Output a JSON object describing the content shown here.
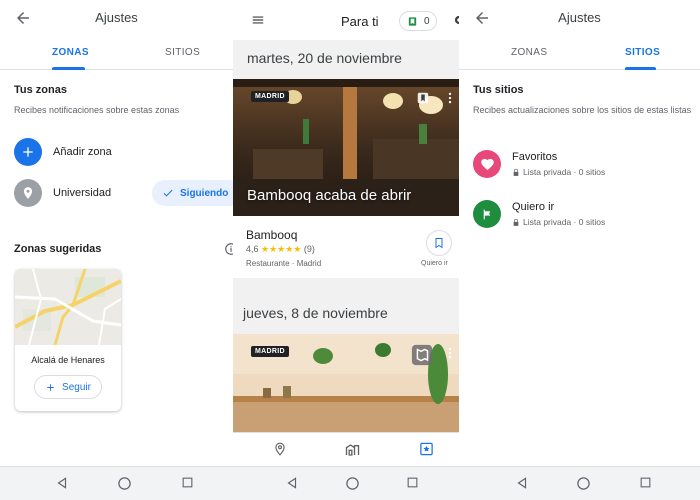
{
  "zones_screen": {
    "title": "Ajustes",
    "tabs": [
      {
        "label": "ZONAS"
      },
      {
        "label": "SITIOS"
      }
    ],
    "section_title": "Tus zonas",
    "section_subtitle": "Recibes notificaciones sobre estas zonas",
    "add_zone_label": "Añadir zona",
    "zone_name": "Universidad",
    "following_label": "Siguiendo",
    "suggested_title": "Zonas sugeridas",
    "suggested_card": {
      "name": "Alcalá de Henares",
      "follow_label": "Seguir"
    }
  },
  "feed_screen": {
    "header_title": "Para ti",
    "header_count": "0",
    "posts": [
      {
        "date": "martes, 20 de noviembre",
        "badge": "MADRID",
        "photo_caption": "Bambooq acaba de abrir",
        "place_name": "Bambooq",
        "rating": "4,6",
        "stars": "★★★★★",
        "reviews": "(9)",
        "category": "Restaurante · Madrid",
        "save_label": "Quiero ir"
      },
      {
        "date": "jueves, 8 de noviembre",
        "badge": "MADRID"
      }
    ]
  },
  "sites_screen": {
    "title": "Ajustes",
    "tabs": [
      {
        "label": "ZONAS"
      },
      {
        "label": "SITIOS"
      }
    ],
    "section_title": "Tus sitios",
    "section_subtitle": "Recibes actualizaciones sobre los sitios de estas listas",
    "lists": [
      {
        "name": "Favoritos",
        "meta": "Lista privada · 0 sitios"
      },
      {
        "name": "Quiero ir",
        "meta": "Lista privada · 0 sitios"
      }
    ]
  },
  "colors": {
    "accent": "#1a73e8",
    "favorites": "#e8477a",
    "want_to_go": "#1e8e3e"
  }
}
